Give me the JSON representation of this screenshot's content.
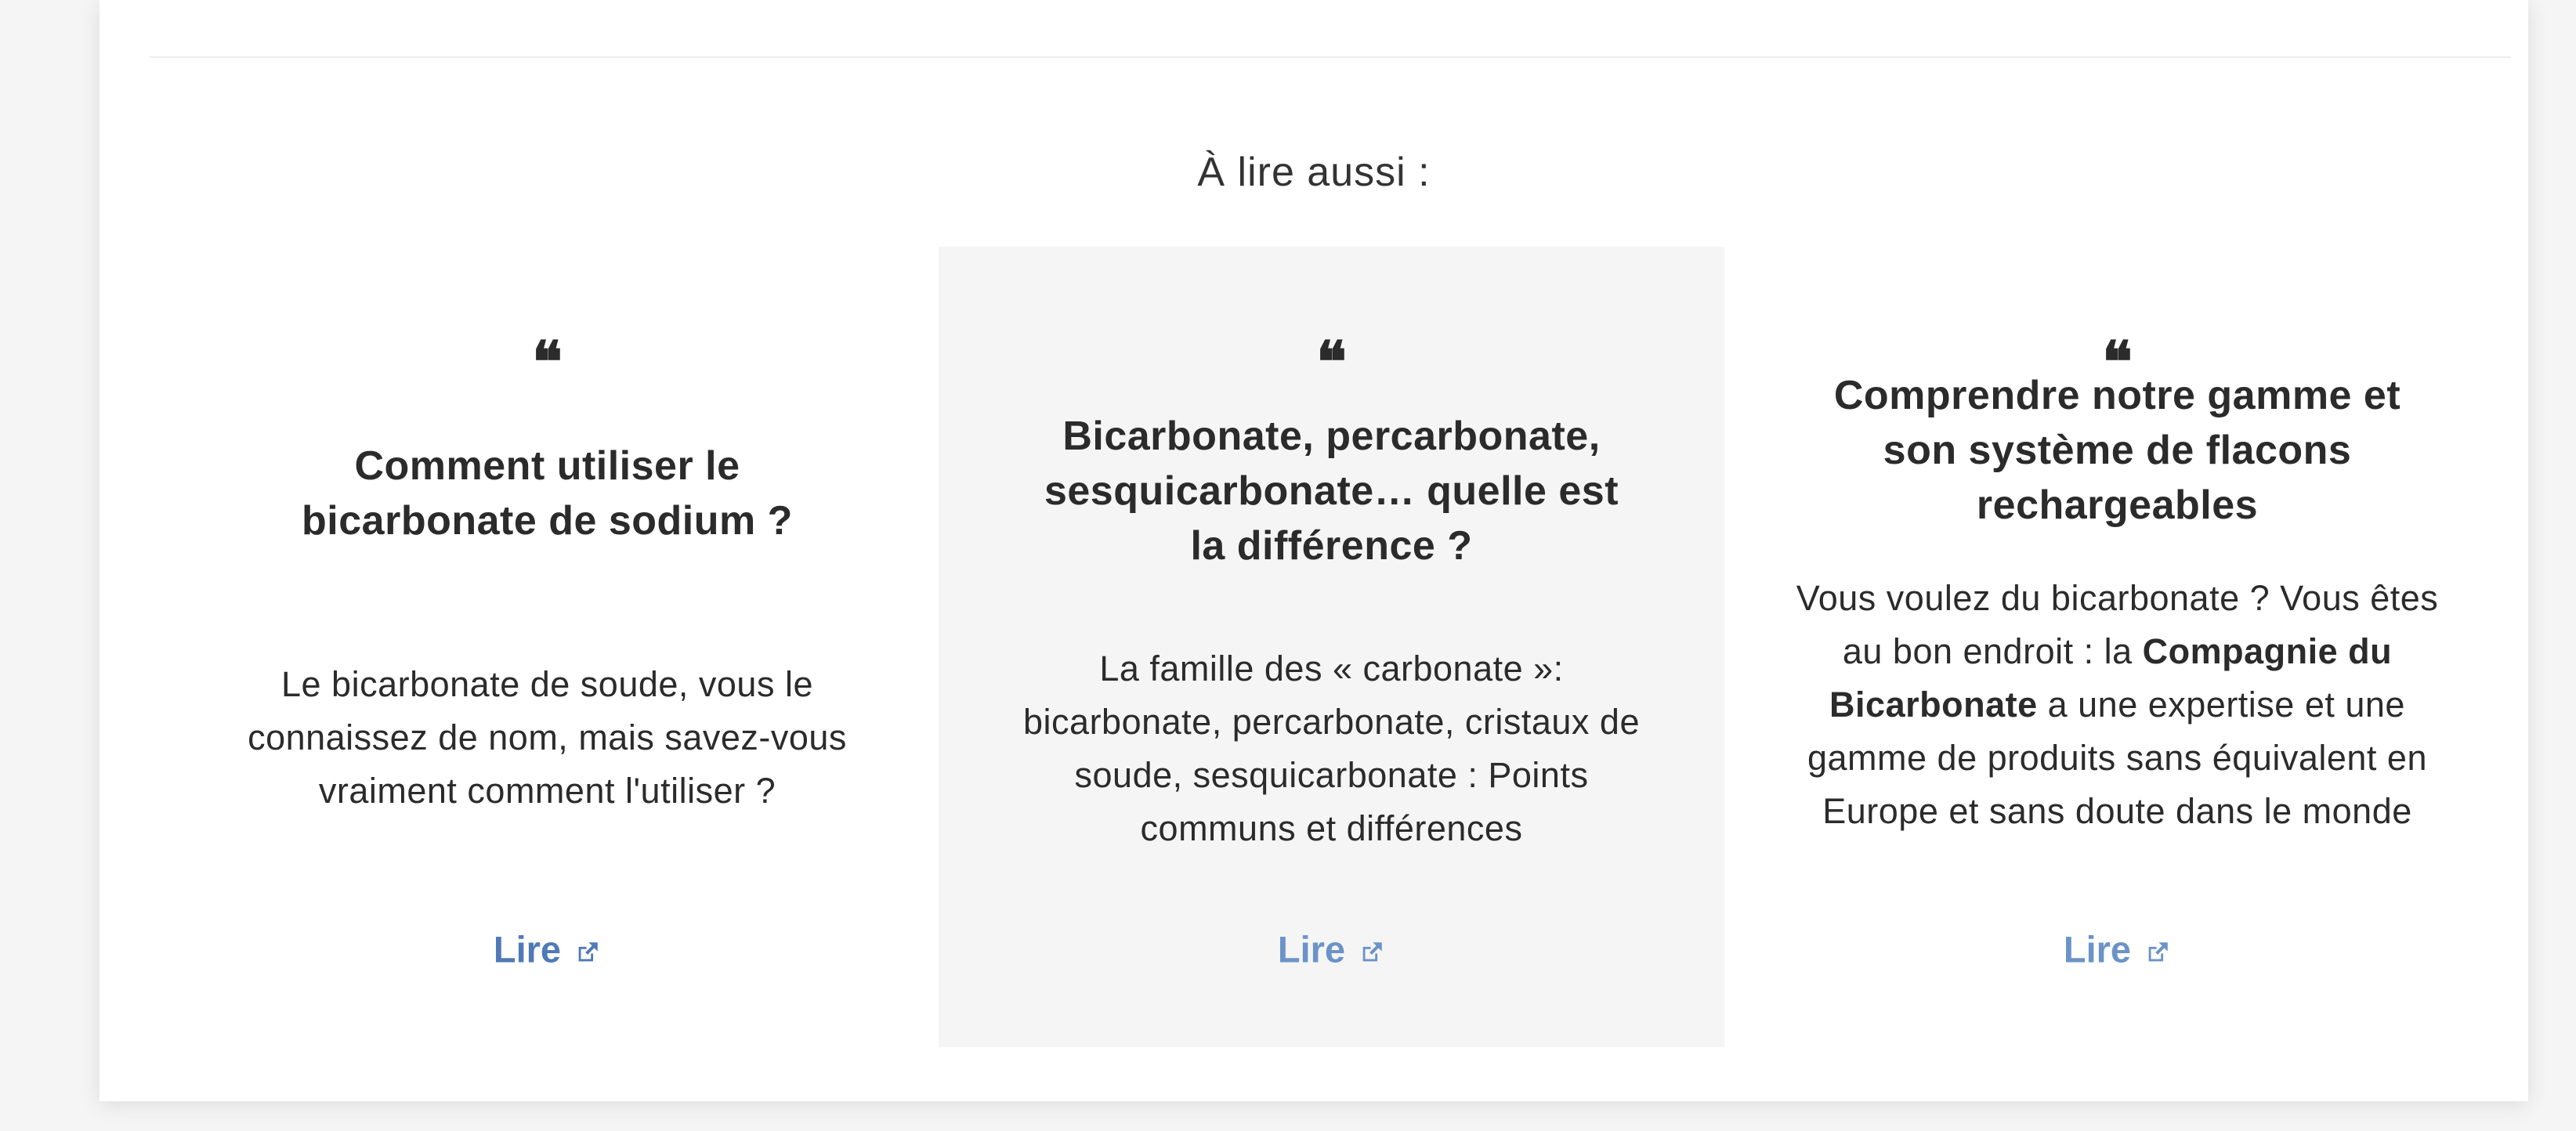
{
  "section": {
    "title": "À lire aussi :"
  },
  "cards": [
    {
      "quote_icon": "quote-icon",
      "title": "Comment utiliser le bicarbonate de sodium ?",
      "description": "Le bicarbonate de soude, vous le connaissez de nom, mais savez-vous vraiment comment l'utiliser ?",
      "link_label": "Lire",
      "link_icon": "external-link-icon"
    },
    {
      "quote_icon": "quote-icon",
      "title": "Bicarbonate, percarbonate, sesquicarbonate… quelle est la différence ?",
      "description": "La famille des « carbonate »: bicarbonate, percarbonate, cristaux de soude, sesquicarbonate : Points communs et différences",
      "link_label": "Lire",
      "link_icon": "external-link-icon"
    },
    {
      "quote_icon": "quote-icon",
      "title": "Comprendre notre gamme et son système de flacons rechargeables",
      "description_parts": {
        "before": "Vous voulez du bicarbonate ? Vous êtes au bon endroit : la ",
        "bold": "Compagnie du Bicarbonate",
        "after": " a une expertise et une gamme de produits sans équivalent en Europe et sans doute dans le monde"
      },
      "link_label": "Lire",
      "link_icon": "external-link-icon"
    }
  ],
  "colors": {
    "link_primary": "#4f7ab6",
    "link_secondary": "#6b93c8",
    "highlight_card_bg": "#f5f5f5",
    "text": "#2b2b2b"
  }
}
